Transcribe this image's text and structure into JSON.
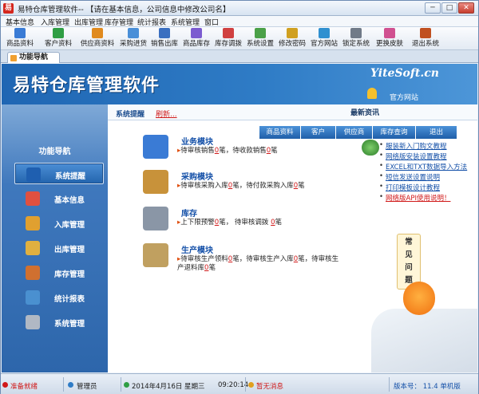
{
  "window": {
    "title": "易特仓库管理软件-- 【请在基本信息，公司信息中修改公司名】",
    "app_icon_glyph": "易",
    "controls": {
      "minimize": "─",
      "maximize": "□",
      "close": "✕"
    }
  },
  "menubar": [
    "基本信息",
    "入库管理",
    "出库管理",
    "库存管理",
    "统计报表",
    "系统管理",
    "窗口"
  ],
  "toolbar": [
    {
      "label": "商品资料",
      "icon": "product-icon",
      "color": "#3a7bd5"
    },
    {
      "label": "客户资料",
      "icon": "customer-icon",
      "color": "#2f9e44"
    },
    {
      "label": "供应商资料",
      "icon": "supplier-icon",
      "color": "#e08a1e"
    },
    {
      "label": "采购进货",
      "icon": "purchase-icon",
      "color": "#4a8fd8"
    },
    {
      "label": "销售出库",
      "icon": "sales-icon",
      "color": "#3a6fc0"
    },
    {
      "label": "商品库存",
      "icon": "stock-icon",
      "color": "#7b5bd0"
    },
    {
      "label": "库存调拨",
      "icon": "transfer-icon",
      "color": "#d04040"
    },
    {
      "label": "系统设置",
      "icon": "settings-icon",
      "color": "#4aa048"
    },
    {
      "label": "修改密码",
      "icon": "password-icon",
      "color": "#d0a020"
    },
    {
      "label": "官方网站",
      "icon": "website-icon",
      "color": "#3090d0"
    },
    {
      "label": "锁定系统",
      "icon": "lock-icon",
      "color": "#707a88"
    },
    {
      "label": "更换皮肤",
      "icon": "skin-icon",
      "color": "#d05090"
    },
    {
      "label": "退出系统",
      "icon": "exit-icon",
      "color": "#c05020"
    }
  ],
  "tab": {
    "label": "功能导航"
  },
  "banner": {
    "title": "易特仓库管理软件",
    "site": "YiteSoft.cn",
    "link": "官方网站"
  },
  "sidebar": {
    "title": "功能导航",
    "items": [
      {
        "label": "系统提醒",
        "icon": "info-icon",
        "color": "#1f5fb0",
        "active": true
      },
      {
        "label": "基本信息",
        "icon": "cubes-icon",
        "color": "#e05040"
      },
      {
        "label": "入库管理",
        "icon": "box-in-icon",
        "color": "#e0a030"
      },
      {
        "label": "出库管理",
        "icon": "box-out-icon",
        "color": "#e0b040"
      },
      {
        "label": "库存管理",
        "icon": "warehouse-icon",
        "color": "#d07030"
      },
      {
        "label": "统计报表",
        "icon": "chart-icon",
        "color": "#4a90d0"
      },
      {
        "label": "系统管理",
        "icon": "gears-icon",
        "color": "#b0b8c4"
      }
    ]
  },
  "main": {
    "remind_title": "系统提醒",
    "refresh": "刷新...",
    "news_title": "最新资讯",
    "news_tabs": [
      "商品资料",
      "客户",
      "供应商",
      "库存查询",
      "退出"
    ],
    "modules": [
      {
        "title": "业务模块",
        "icon": "keyboard-icon",
        "color": "#3a7bd5",
        "parts": [
          [
            "待审核销售",
            "0",
            "笔，待收款销售"
          ],
          [
            "",
            "0",
            "笔"
          ]
        ]
      },
      {
        "title": "采购模块",
        "icon": "purchase-box-icon",
        "color": "#c8923a",
        "parts": [
          [
            "待审核采购入库",
            "0",
            "笔，待付款采购入库"
          ],
          [
            "",
            "0",
            "笔"
          ]
        ]
      },
      {
        "title": "库存",
        "icon": "disk-icon",
        "color": "#8a96a6",
        "parts": [
          [
            "上下限预警",
            "0",
            "笔，   待审核调拨 "
          ],
          [
            "",
            "0",
            "笔"
          ]
        ]
      },
      {
        "title": "生产模块",
        "icon": "clipboard-icon",
        "color": "#c0a060",
        "parts": [
          [
            "待审核生产领料",
            "0",
            "笔，待审核生产入库"
          ],
          [
            "",
            "0",
            "笔，待审核生产退料库"
          ],
          [
            "",
            "0",
            "笔"
          ]
        ]
      }
    ],
    "news": [
      {
        "text": "服装新入门购文教程",
        "red": false
      },
      {
        "text": "网络版安装设置教程",
        "red": false
      },
      {
        "text": "EXCEL和TXT数据导入方法",
        "red": false
      },
      {
        "text": "短信发送设置说明",
        "red": false
      },
      {
        "text": "打印模板设计教程",
        "red": false
      },
      {
        "text": "网络版API使用说明！",
        "red": true
      }
    ],
    "faq": [
      "常",
      "见",
      "问",
      "题"
    ]
  },
  "statusbar": {
    "ready": "准备就绪",
    "user": "管理员",
    "date": "2014年4月16日  星期三",
    "time": "09:20:14",
    "message": "暂无消息",
    "version": "版本号： 11.4  单机版"
  }
}
